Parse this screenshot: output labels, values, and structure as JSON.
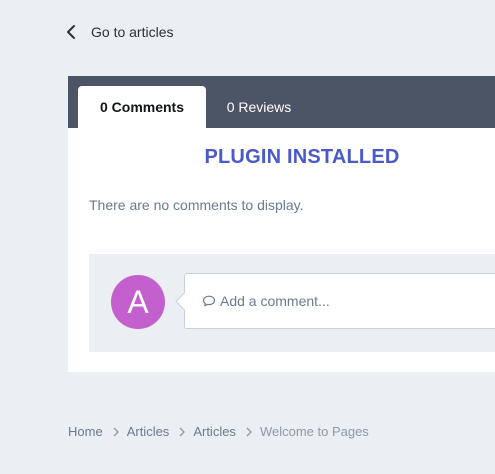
{
  "back_link": {
    "label": "Go to articles",
    "icon": "chevron-left-icon"
  },
  "tabs": [
    {
      "label": "0 Comments",
      "active": true
    },
    {
      "label": "0 Reviews",
      "active": false
    }
  ],
  "comments": {
    "plugin_notice": "PLUGIN INSTALLED",
    "empty_message": "There are no comments to display.",
    "avatar_letter": "A",
    "comment_placeholder": "Add a comment...",
    "comment_icon": "speech-bubble-icon"
  },
  "breadcrumb": {
    "items": [
      "Home",
      "Articles",
      "Articles",
      "Welcome to Pages"
    ],
    "separator_icon": "chevron-right-icon"
  },
  "colors": {
    "page_bg": "#ebeef3",
    "tabbar_bg": "#4b5566",
    "accent_title": "#4a5ac9",
    "avatar_bg": "#c360cd",
    "muted_text": "#6b7a90"
  }
}
